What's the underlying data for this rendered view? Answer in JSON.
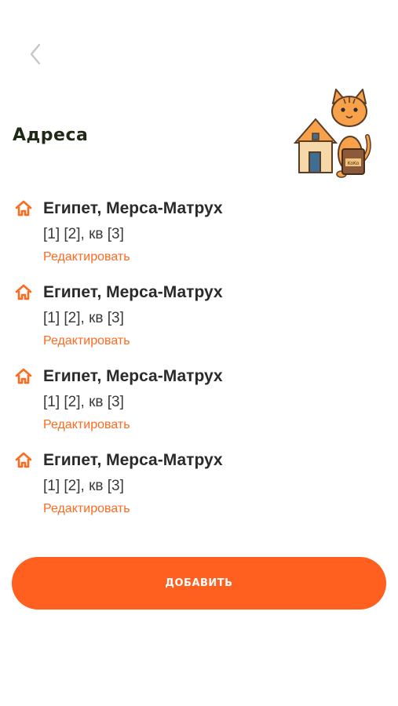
{
  "header": {
    "back_icon": "chevron-left-icon",
    "title": "Адреса"
  },
  "mascot": {
    "icon": "cat-with-house-illustration",
    "bag_text": "KoKo"
  },
  "addresses": [
    {
      "title": "Египет, Мерса-Матрух",
      "detail": "[1] [2], кв [3]",
      "edit_label": "Редактировать"
    },
    {
      "title": "Египет, Мерса-Матрух",
      "detail": "[1] [2], кв [3]",
      "edit_label": "Редактировать"
    },
    {
      "title": "Египет, Мерса-Матрух",
      "detail": "[1] [2], кв [3]",
      "edit_label": "Редактировать"
    },
    {
      "title": "Египет, Мерса-Матрух",
      "detail": "[1] [2], кв [3]",
      "edit_label": "Редактировать"
    }
  ],
  "address_icon": "home-icon",
  "actions": {
    "add_label": "ДОБАВИТЬ"
  },
  "colors": {
    "accent": "#ff5f1f",
    "link": "#ff6a1f",
    "title": "#1e2a16",
    "text": "#2a2a2a"
  }
}
